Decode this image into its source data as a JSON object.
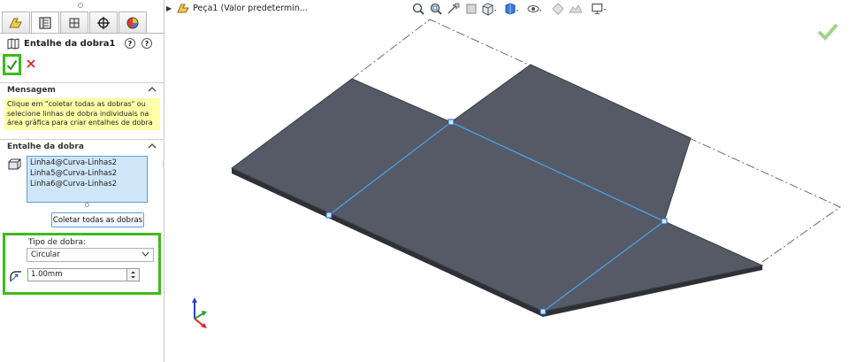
{
  "feature": {
    "title": "Entalhe da dobra1"
  },
  "sections": {
    "message": {
      "title": "Mensagem",
      "text": "Clique em \"coletar todas as dobras\" ou selecione linhas de dobra individuais na área gráfica para criar entalhes de dobra"
    },
    "bend_relief": {
      "title": "Entalhe da dobra",
      "edges": [
        "Linha4@Curva-Linhas2",
        "Linha5@Curva-Linhas2",
        "Linha6@Curva-Linhas2"
      ],
      "collect_button_label": "Coletar todas as dobras"
    },
    "bend_type": {
      "label": "Tipo de dobra:",
      "selected": "Circular",
      "radius": "1.00mm"
    }
  },
  "viewport": {
    "part_name": "Peça1 (Valor predetermin..."
  },
  "colors": {
    "accent_highlight": "#3dbb1a",
    "message_bg": "#ffffa8",
    "selection_blue": "#5aa0d8",
    "sheet_face": "#555a66",
    "bend_line": "#4aa0e8"
  },
  "icons": [
    "confirm-check-icon",
    "cancel-x-icon",
    "help-icon",
    "question-icon",
    "sheet-metal-icon",
    "edge-selection-icon",
    "bend-radius-icon",
    "chevron-up-icon",
    "chevron-down-icon",
    "zoom-fit-icon",
    "zoom-area-icon",
    "previous-view-icon",
    "section-view-icon",
    "view-orientation-icon",
    "display-style-icon",
    "hide-show-icon",
    "appearance-icon",
    "scene-icon",
    "display-settings-icon",
    "triad-icon"
  ]
}
